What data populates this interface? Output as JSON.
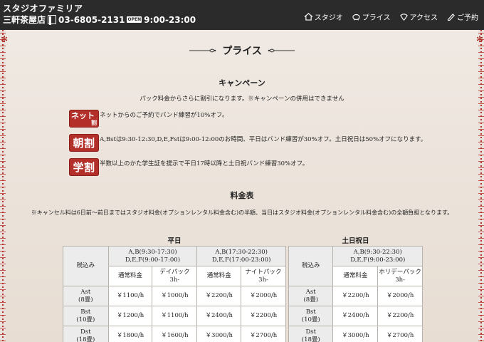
{
  "header": {
    "site_name": "スタジオファミリア",
    "branch": "三軒茶屋店",
    "phone": "03-6805-2131",
    "open_badge": "OPEN",
    "hours": "9:00-23:00",
    "nav": [
      {
        "label": "スタジオ",
        "icon": "house-icon"
      },
      {
        "label": "プライス",
        "icon": "piggy-bank-icon"
      },
      {
        "label": "アクセス",
        "icon": "map-pin-icon"
      },
      {
        "label": "ご予約",
        "icon": "pencil-icon"
      }
    ]
  },
  "page_title": "プライス",
  "campaign": {
    "title": "キャンペーン",
    "intro": "パック料金からさらに割引になります。※キャンペーンの併用はできません",
    "items": [
      {
        "badge_main": "ネット",
        "badge_sub": "割",
        "text": "ネットからのご予約でバンド練習が10%オフ。"
      },
      {
        "badge_main": "朝割",
        "text": "A,Bstは9:30-12:30,D,E,Fstは9:00-12:00のお時間、平日はバンド練習が30%オフ。土日祝日は50%オフになります。"
      },
      {
        "badge_main": "学割",
        "text": "半数以上のかた学生証を提示で平日17時以降と土日祝バンド練習30%オフ。"
      }
    ]
  },
  "price_table": {
    "title": "料金表",
    "note": "※キャンセル料は6日前～前日まではスタジオ料金(オプションレンタル料金含む)の半額、当日はスタジオ料金(オプションレンタル料金含む)の全額負担となります。",
    "weekday": {
      "caption": "平日",
      "corner": "税込み",
      "groups": [
        {
          "line1": "A,B(9:30-17:30)",
          "line2": "D,E,F(9:00-17:00)",
          "col_a": "通常料金",
          "col_b1": "デイパック",
          "col_b2": "3h-"
        },
        {
          "line1": "A,B(17:30-22:30)",
          "line2": "D,E,F(17:00-23:00)",
          "col_a": "通常料金",
          "col_b1": "ナイトパック",
          "col_b2": "3h-"
        }
      ],
      "rows": [
        {
          "st": "Ast",
          "size": "(8畳)",
          "v": [
            "￥1100/h",
            "￥1000/h",
            "￥2200/h",
            "￥2000/h"
          ]
        },
        {
          "st": "Bst",
          "size": "(10畳)",
          "v": [
            "￥1200/h",
            "￥1100/h",
            "￥2400/h",
            "￥2200/h"
          ]
        },
        {
          "st": "Dst",
          "size": "(18畳)",
          "v": [
            "￥1800/h",
            "￥1600/h",
            "￥3000/h",
            "￥2700/h"
          ]
        }
      ]
    },
    "holiday": {
      "caption": "土日祝日",
      "corner": "税込み",
      "group": {
        "line1": "A,B(9:30-22:30)",
        "line2": "D,E,F(9:00-23:00)",
        "col_a": "通常料金",
        "col_b1": "ホリデーパック",
        "col_b2": "3h-"
      },
      "rows": [
        {
          "st": "Ast",
          "size": "(8畳)",
          "v": [
            "￥2200/h",
            "￥2000/h"
          ]
        },
        {
          "st": "Bst",
          "size": "(10畳)",
          "v": [
            "￥2400/h",
            "￥2200/h"
          ]
        },
        {
          "st": "Dst",
          "size": "(18畳)",
          "v": [
            "￥3000/h",
            "￥2700/h"
          ]
        }
      ]
    }
  },
  "colors": {
    "header_bg": "#2b2b2b",
    "badge_red": "#b3302a",
    "border_red": "#b2342c"
  }
}
